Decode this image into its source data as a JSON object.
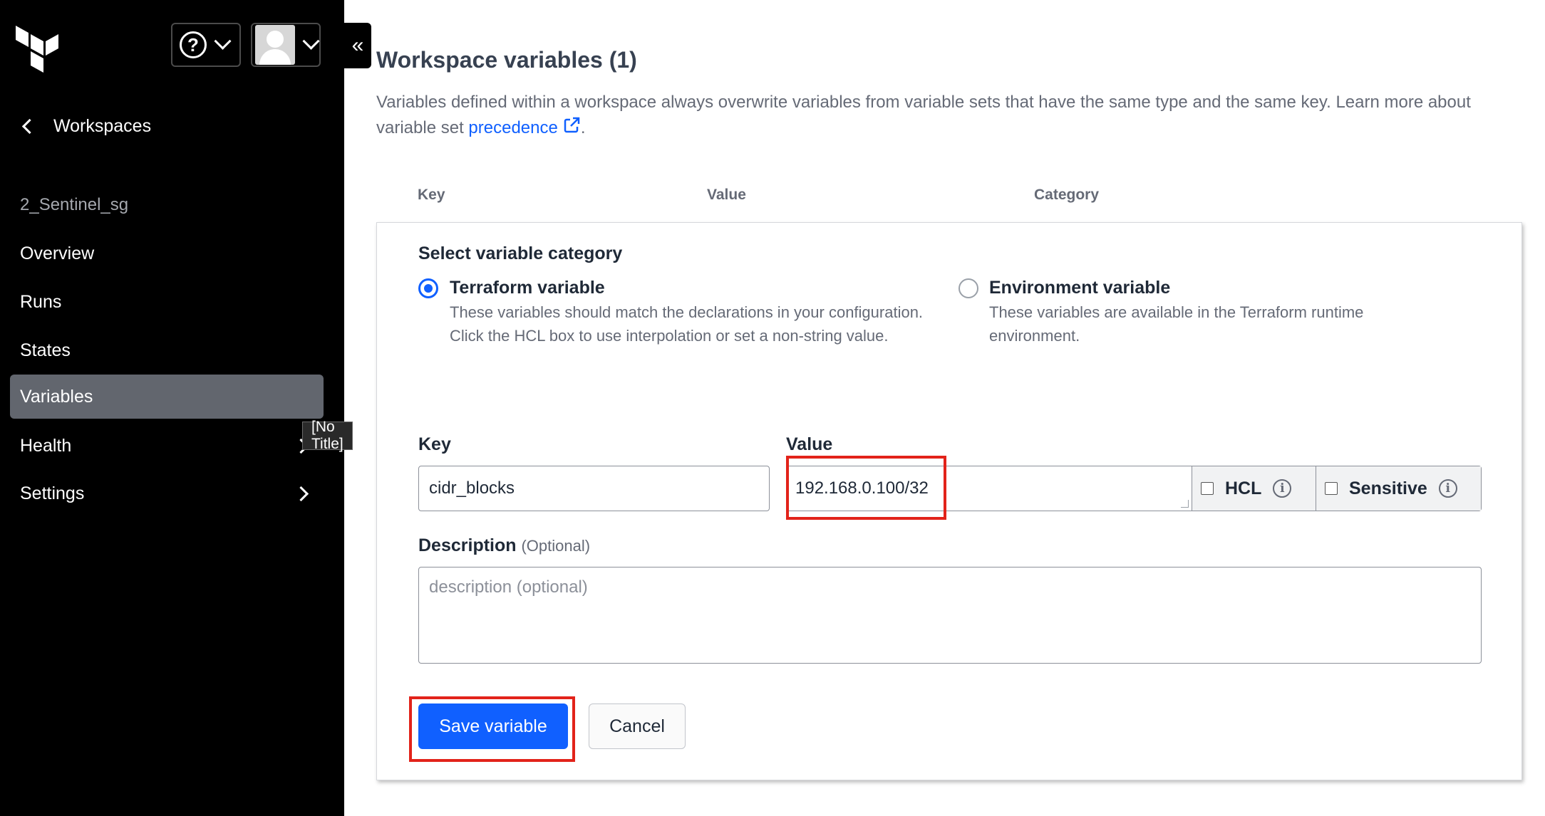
{
  "sidebar": {
    "back_label": "Workspaces",
    "workspace_name": "2_Sentinel_sg",
    "help_symbol": "?",
    "collapse_symbol": "«",
    "items": [
      {
        "label": "Overview"
      },
      {
        "label": "Runs"
      },
      {
        "label": "States"
      },
      {
        "label": "Variables",
        "active": true
      },
      {
        "label": "Health",
        "has_submenu": true
      },
      {
        "label": "Settings",
        "has_submenu": true
      }
    ],
    "tooltip": "[No Title]"
  },
  "main": {
    "title": "Workspace variables (1)",
    "intro_text": "Variables defined within a workspace always overwrite variables from variable sets that have the same type and the same key. Learn more about variable set ",
    "intro_link": "precedence",
    "intro_end": ".",
    "columns": [
      "Key",
      "Value",
      "Category"
    ]
  },
  "form": {
    "category_heading": "Select variable category",
    "categories": [
      {
        "label": "Terraform variable",
        "description": "These variables should match the declarations in your configuration. Click the HCL box to use interpolation or set a non-string value.",
        "selected": true
      },
      {
        "label": "Environment variable",
        "description": "These variables are available in the Terraform runtime environment.",
        "selected": false
      }
    ],
    "key_label": "Key",
    "key_value": "cidr_blocks",
    "value_label": "Value",
    "value_value": "192.168.0.100/32",
    "hcl_label": "HCL",
    "sensitive_label": "Sensitive",
    "info_symbol": "i",
    "description_label": "Description",
    "description_optional": "(Optional)",
    "description_placeholder": "description (optional)",
    "save_label": "Save variable",
    "cancel_label": "Cancel"
  },
  "colors": {
    "sidebar_bg": "#000000",
    "active_nav": "#62666e",
    "accent": "#1060ff",
    "highlight": "#e2231a"
  }
}
